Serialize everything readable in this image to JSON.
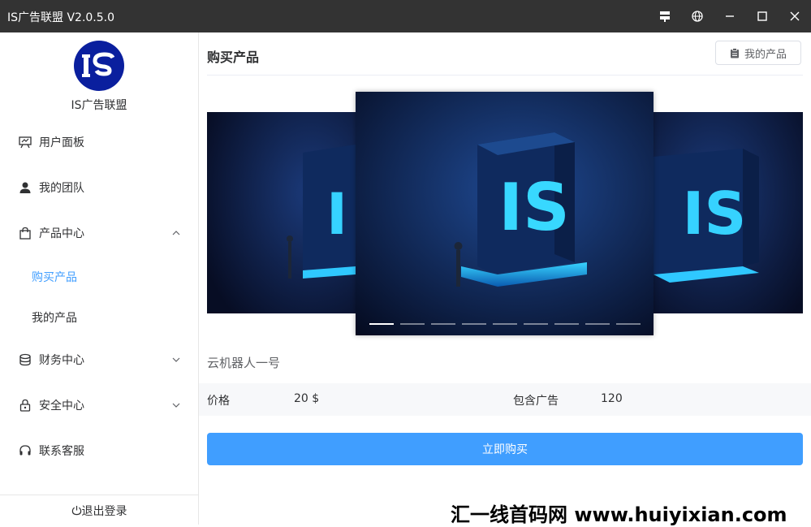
{
  "window": {
    "title": "IS广告联盟 V2.0.5.0"
  },
  "sidebar": {
    "logo_text": "IS广告联盟",
    "items": [
      {
        "label": "用户面板"
      },
      {
        "label": "我的团队"
      },
      {
        "label": "产品中心"
      },
      {
        "label": "财务中心"
      },
      {
        "label": "安全中心"
      },
      {
        "label": "联系客服"
      }
    ],
    "sub_items": [
      {
        "label": "购买产品"
      },
      {
        "label": "我的产品"
      }
    ],
    "logout": "退出登录"
  },
  "header": {
    "title": "购买产品",
    "my_products_button": "我的产品"
  },
  "product": {
    "name": "云机器人一号",
    "price_label": "价格",
    "price_value": "20 $",
    "ads_label": "包含广告",
    "ads_value": "120",
    "buy_button": "立即购买"
  },
  "carousel": {
    "count": 9,
    "active_index": 0
  },
  "watermark": "汇一线首码网 www.huiyixian.com",
  "colors": {
    "accent": "#409eff",
    "titlebar": "#333333",
    "logo": "#0a1f9e"
  }
}
